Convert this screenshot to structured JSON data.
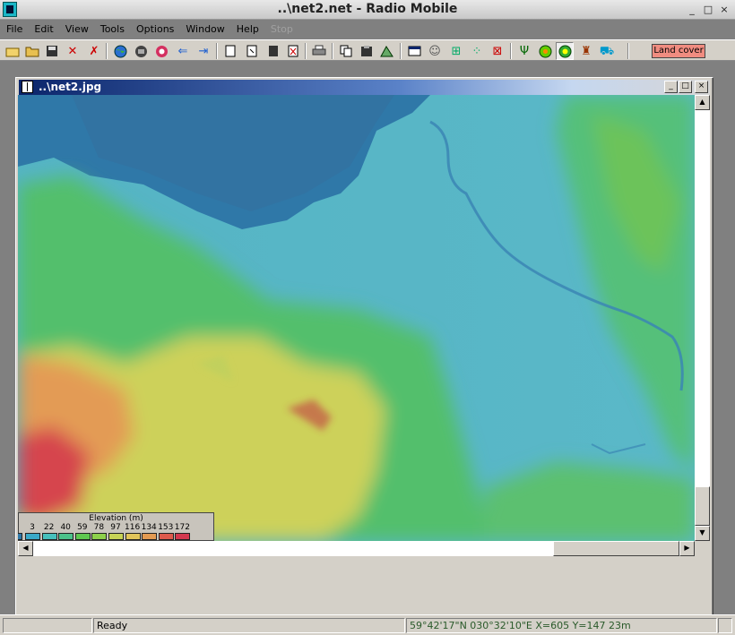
{
  "window": {
    "title": "..\\net2.net - Radio Mobile",
    "buttons": [
      "_",
      "□",
      "×"
    ]
  },
  "menu": [
    "File",
    "Edit",
    "View",
    "Tools",
    "Options",
    "Window",
    "Help",
    "Stop"
  ],
  "toolbar": {
    "icons": [
      "new-folder-icon",
      "open-folder-icon",
      "save-icon",
      "network-properties-icon",
      "network-edit-icon",
      "globe-icon",
      "map-properties-icon",
      "world-icon",
      "back-arrow-icon",
      "forward-arrow-icon",
      "sheet-icon",
      "sheet-new-icon",
      "sheet-save-icon",
      "sheet-close-icon",
      "print-icon",
      "copy-icon",
      "paste-icon",
      "merge-icon",
      "window-icon",
      "people-icon",
      "grid-icon",
      "nodes-icon",
      "close-network-icon",
      "antenna-icon",
      "radar-icon",
      "coverage-icon",
      "tower-icon",
      "route-icon"
    ],
    "land_cover_label": "Land cover"
  },
  "child": {
    "title": "..\\net2.jpg",
    "buttons": [
      "_",
      "□",
      "×"
    ]
  },
  "legend": {
    "title": "Elevation (m)",
    "ticks": [
      "3",
      "22",
      "40",
      "59",
      "78",
      "97",
      "116",
      "134",
      "153",
      "172"
    ],
    "colors": [
      "#3aa9c8",
      "#47c0bc",
      "#4cc28a",
      "#5fc84f",
      "#8ed04b",
      "#c7d255",
      "#e1c45a",
      "#e39a52",
      "#de5a4c",
      "#d3384e"
    ]
  },
  "status": {
    "ready": "Ready",
    "coordinates": "59°42'17\"N 030°32'10\"E  X=605 Y=147 23m"
  }
}
